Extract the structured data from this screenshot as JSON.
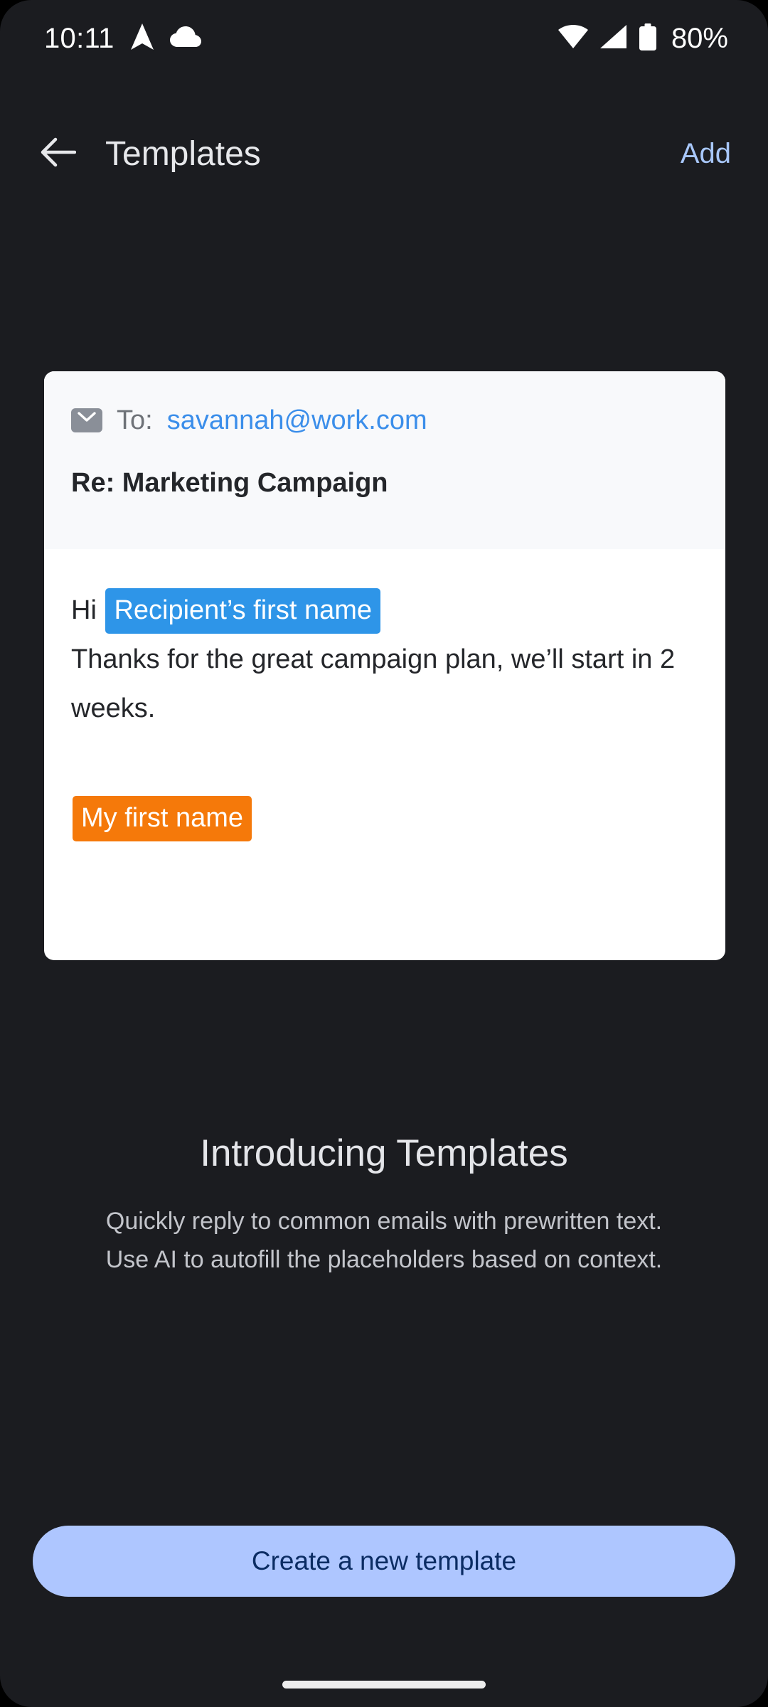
{
  "status_bar": {
    "time": "10:11",
    "battery_percent": "80%",
    "icons": [
      "navigation-arrow-icon",
      "cloud-icon",
      "wifi-icon",
      "cellular-signal-icon",
      "battery-icon"
    ]
  },
  "app_bar": {
    "back_icon": "arrow-left-icon",
    "title": "Templates",
    "add_label": "Add"
  },
  "template_card": {
    "envelope_icon": "envelope-icon",
    "to_label": "To:",
    "to_address": "savannah@work.com",
    "subject": "Re: Marketing Campaign",
    "greeting_prefix": "Hi",
    "recipient_placeholder": "Recipient’s first name",
    "body_text": "Thanks  for the great campaign plan, we’ll start in 2 weeks.",
    "sender_placeholder": "My first name"
  },
  "promo": {
    "title": "Introducing Templates",
    "description": "Quickly reply to common emails with prewritten text. Use AI to autofill the placeholders based on context."
  },
  "cta": {
    "label": "Create a new template"
  },
  "colors": {
    "background": "#1B1C20",
    "accent_blue": "#A8C7FA",
    "cta_fill": "#AEC6FF",
    "cta_text": "#0B2C63",
    "link_blue": "#3B8EEA",
    "chip_recipient": "#2E95E8",
    "chip_sender": "#F5790A",
    "card_head": "#F8F9FB",
    "card_body": "#FFFFFF"
  }
}
